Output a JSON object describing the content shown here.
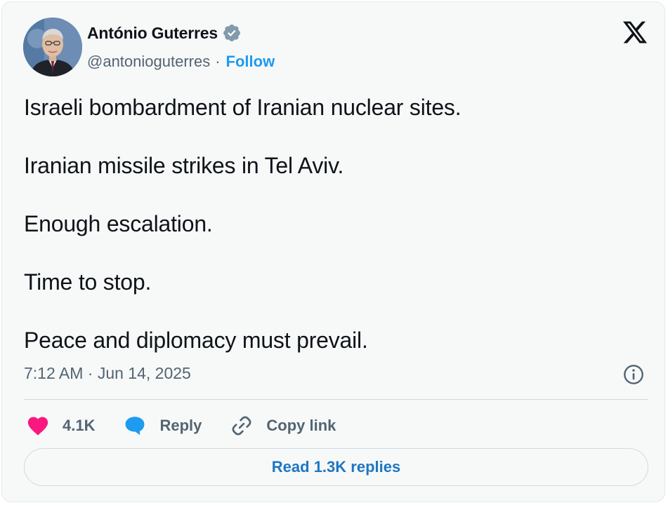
{
  "author": {
    "name": "António Guterres",
    "handle": "@antonioguterres",
    "separator": "·",
    "follow_label": "Follow",
    "verified": true,
    "avatar_icon": "profile-photo"
  },
  "tweet": {
    "paragraphs": [
      "Israeli bombardment of Iranian nuclear sites.",
      "Iranian missile strikes in Tel Aviv.",
      "Enough escalation.",
      "Time to stop.",
      "Peace and diplomacy must prevail."
    ],
    "timestamp": "7:12 AM · Jun 14, 2025"
  },
  "actions": {
    "like_count": "4.1K",
    "reply_label": "Reply",
    "copy_link_label": "Copy link"
  },
  "read_replies_label": "Read 1.3K replies",
  "icons": {
    "brand": "x-logo-icon",
    "verified": "verified-badge-icon",
    "info": "info-icon",
    "like": "heart-icon",
    "reply": "reply-bubble-icon",
    "copy_link": "link-icon"
  },
  "colors": {
    "background": "#f7f9f9",
    "text": "#0f1419",
    "secondary_text": "#536471",
    "link": "#1d9bf0",
    "heart": "#f91880",
    "reply_bubble": "#1d9bf0",
    "verified_badge": "#829aab"
  }
}
